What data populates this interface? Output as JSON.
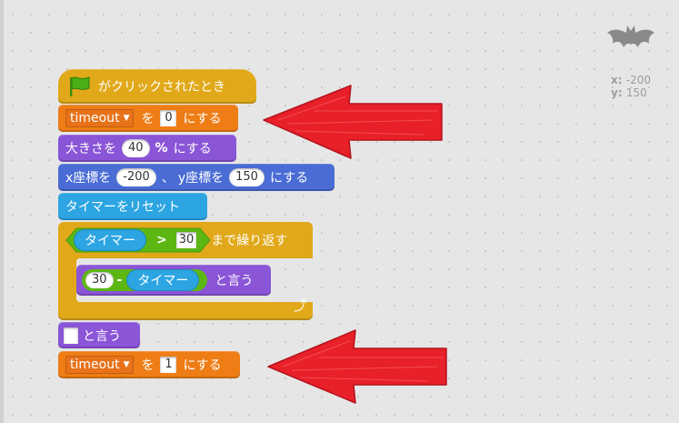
{
  "sprite": {
    "icon": "bat-icon",
    "coords": {
      "x_label": "x:",
      "x_value": "-200",
      "y_label": "y:",
      "y_value": "150"
    }
  },
  "script": {
    "hat": {
      "label": "がクリックされたとき",
      "icon": "green-flag-icon"
    },
    "set_timeout_0": {
      "variable": "timeout",
      "word": "を",
      "value": "0",
      "suffix": "にする"
    },
    "set_size": {
      "label": "大きさを",
      "value": "40",
      "unit": "%",
      "suffix": "にする"
    },
    "goto_xy": {
      "x_label": "x座標を",
      "x_value": "-200",
      "sep": "、",
      "y_label": "y座標を",
      "y_value": "150",
      "suffix": "にする"
    },
    "reset_timer": {
      "label": "タイマーをリセット"
    },
    "repeat_until": {
      "reporter": "タイマー",
      "operator": ">",
      "value": "30",
      "suffix": "まで繰り返す",
      "loop_icon": "loop-arrow-icon"
    },
    "say_inner": {
      "num": "30",
      "op": "-",
      "reporter": "タイマー",
      "suffix": "と言う"
    },
    "say_empty": {
      "value": "",
      "suffix": "と言う"
    },
    "set_timeout_1": {
      "variable": "timeout",
      "word": "を",
      "value": "1",
      "suffix": "にする"
    }
  },
  "colors": {
    "data": "#ee7d16",
    "looks": "#8a55d7",
    "motion": "#4a6cd4",
    "sensing": "#2ca5e2",
    "control": "#e1a91a",
    "operators": "#5cb712",
    "annotation_arrow": "#e8202a"
  }
}
